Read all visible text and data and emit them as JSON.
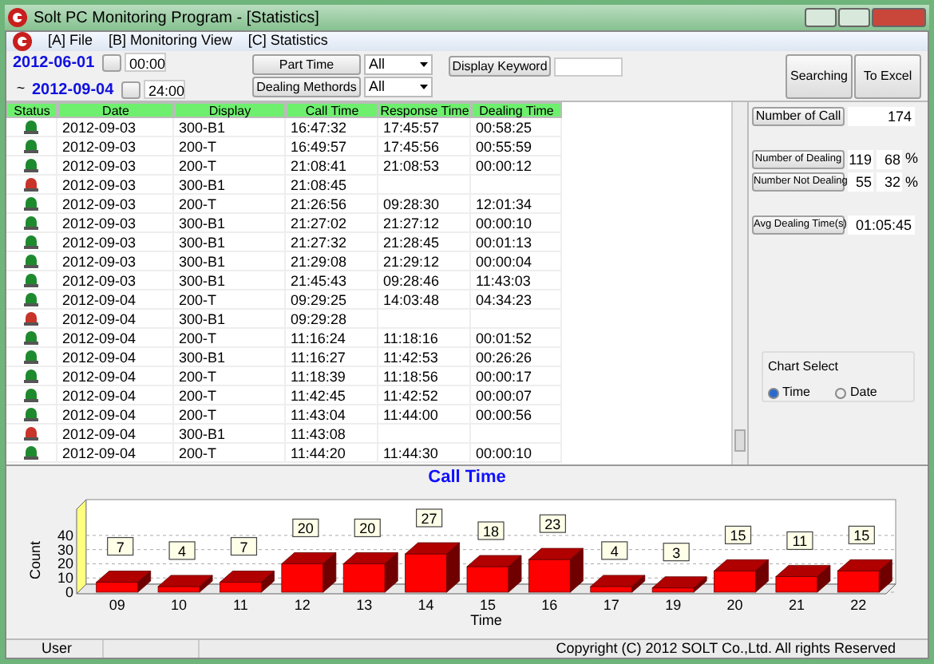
{
  "window": {
    "title": "Solt PC Monitoring Program - [Statistics]"
  },
  "menu": [
    "[A] File",
    "[B] Monitoring View",
    "[C] Statistics"
  ],
  "toolbar": {
    "date_from": "2012-06-01",
    "time_from": "00:00",
    "range_mark": "~",
    "date_to": "2012-09-04",
    "time_to": "24:00",
    "filters": [
      {
        "label": "Part Time",
        "value": "All"
      },
      {
        "label": "Dealing Methords",
        "value": "All"
      }
    ],
    "keyword_button": "Display Keyword",
    "buttons": [
      "Searching",
      "To Excel"
    ]
  },
  "table": {
    "columns": [
      "Status",
      "Date",
      "Display",
      "Call Time",
      "Response Time",
      "Dealing Time"
    ],
    "rows": [
      {
        "color": "#1e8a2e",
        "date": "2012-09-03",
        "display": "300-B1",
        "call": "16:47:32",
        "response": "17:45:57",
        "dealing": "00:58:25"
      },
      {
        "color": "#1e8a2e",
        "date": "2012-09-03",
        "display": "200-T",
        "call": "16:49:57",
        "response": "17:45:56",
        "dealing": "00:55:59"
      },
      {
        "color": "#1e8a2e",
        "date": "2012-09-03",
        "display": "200-T",
        "call": "21:08:41",
        "response": "21:08:53",
        "dealing": "00:00:12"
      },
      {
        "color": "#c8342a",
        "date": "2012-09-03",
        "display": "300-B1",
        "call": "21:08:45",
        "response": "",
        "dealing": ""
      },
      {
        "color": "#1e8a2e",
        "date": "2012-09-03",
        "display": "200-T",
        "call": "21:26:56",
        "response": "09:28:30",
        "dealing": "12:01:34"
      },
      {
        "color": "#1e8a2e",
        "date": "2012-09-03",
        "display": "300-B1",
        "call": "21:27:02",
        "response": "21:27:12",
        "dealing": "00:00:10"
      },
      {
        "color": "#1e8a2e",
        "date": "2012-09-03",
        "display": "300-B1",
        "call": "21:27:32",
        "response": "21:28:45",
        "dealing": "00:01:13"
      },
      {
        "color": "#1e8a2e",
        "date": "2012-09-03",
        "display": "300-B1",
        "call": "21:29:08",
        "response": "21:29:12",
        "dealing": "00:00:04"
      },
      {
        "color": "#1e8a2e",
        "date": "2012-09-03",
        "display": "300-B1",
        "call": "21:45:43",
        "response": "09:28:46",
        "dealing": "11:43:03"
      },
      {
        "color": "#1e8a2e",
        "date": "2012-09-04",
        "display": "200-T",
        "call": "09:29:25",
        "response": "14:03:48",
        "dealing": "04:34:23"
      },
      {
        "color": "#c8342a",
        "date": "2012-09-04",
        "display": "300-B1",
        "call": "09:29:28",
        "response": "",
        "dealing": ""
      },
      {
        "color": "#1e8a2e",
        "date": "2012-09-04",
        "display": "200-T",
        "call": "11:16:24",
        "response": "11:18:16",
        "dealing": "00:01:52"
      },
      {
        "color": "#1e8a2e",
        "date": "2012-09-04",
        "display": "300-B1",
        "call": "11:16:27",
        "response": "11:42:53",
        "dealing": "00:26:26"
      },
      {
        "color": "#1e8a2e",
        "date": "2012-09-04",
        "display": "200-T",
        "call": "11:18:39",
        "response": "11:18:56",
        "dealing": "00:00:17"
      },
      {
        "color": "#1e8a2e",
        "date": "2012-09-04",
        "display": "200-T",
        "call": "11:42:45",
        "response": "11:42:52",
        "dealing": "00:00:07"
      },
      {
        "color": "#1e8a2e",
        "date": "2012-09-04",
        "display": "200-T",
        "call": "11:43:04",
        "response": "11:44:00",
        "dealing": "00:00:56"
      },
      {
        "color": "#c8342a",
        "date": "2012-09-04",
        "display": "300-B1",
        "call": "11:43:08",
        "response": "",
        "dealing": ""
      },
      {
        "color": "#1e8a2e",
        "date": "2012-09-04",
        "display": "200-T",
        "call": "11:44:20",
        "response": "11:44:30",
        "dealing": "00:00:10"
      }
    ]
  },
  "stats": {
    "calls_label": "Number of Call",
    "calls": "174",
    "dealing": [
      {
        "label": "Number of Dealing",
        "count": "119",
        "percent": "68",
        "unit": "%"
      },
      {
        "label": "Number Not Dealing",
        "count": "55",
        "percent": "32",
        "unit": "%"
      }
    ],
    "avg_label": "Avg Dealing Time(s)",
    "avg": "01:05:45"
  },
  "chart_select": {
    "title": "Chart Select",
    "options": [
      {
        "label": "Time",
        "selected": true
      },
      {
        "label": "Date",
        "selected": false
      }
    ]
  },
  "chart_data": {
    "type": "bar",
    "title": "Call Time",
    "xlabel": "Time",
    "ylabel": "Count",
    "categories": [
      "09",
      "10",
      "11",
      "12",
      "13",
      "14",
      "15",
      "16",
      "17",
      "19",
      "20",
      "21",
      "22"
    ],
    "series": [
      {
        "color": "#ff0000",
        "values": [
          7,
          4,
          7,
          20,
          20,
          27,
          18,
          23,
          4,
          3,
          15,
          11,
          15
        ]
      }
    ],
    "ylim": [
      0,
      45
    ],
    "yticks": [
      0,
      10,
      20,
      30,
      40
    ],
    "grid": true,
    "data_labels": true
  },
  "status_bar": {
    "user": "User",
    "copyright": "Copyright (C) 2012 SOLT Co.,Ltd. All rights Reserved"
  }
}
